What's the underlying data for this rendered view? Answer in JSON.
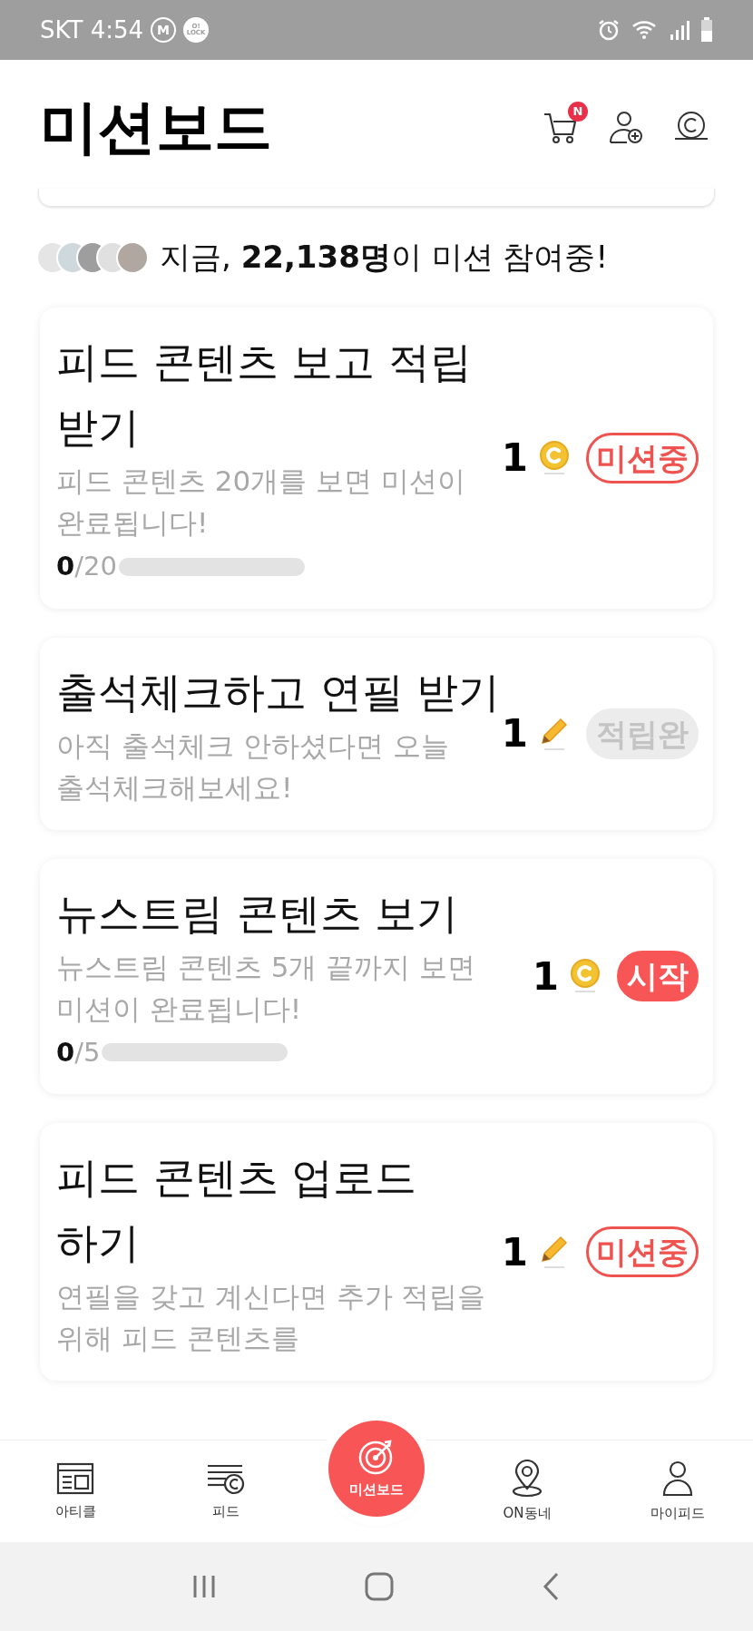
{
  "status_bar": {
    "carrier_time": "SKT 4:54",
    "app_badges": [
      "M",
      "O! LOCK"
    ]
  },
  "header": {
    "title": "미션보드",
    "cart_badge": "N"
  },
  "participants": {
    "text": "지금, **22,138명**이 미션 참여중!"
  },
  "missions": [
    {
      "title": "피드 콘텐츠 보고 적립 받기",
      "description": "피드 콘텐츠 20개를 보면 미션이 완료됩니다!",
      "reward": {
        "amount": "1",
        "kind": "coin"
      },
      "status": {
        "kind": "in_progress",
        "label": "미션중"
      },
      "progress": {
        "current": "0",
        "total": "/20",
        "level": 0
      }
    },
    {
      "title": "출석체크하고 연필 받기",
      "description": "아직 출석체크 안하셨다면 오늘 출석체크해보세요!",
      "reward": {
        "amount": "1",
        "kind": "pencil"
      },
      "status": {
        "kind": "completed",
        "label": "적립완"
      }
    },
    {
      "title": "뉴스트림 콘텐츠 보기",
      "description": "뉴스트림 콘텐츠 5개 끝까지 보면 미션이 완료됩니다!",
      "reward": {
        "amount": "1",
        "kind": "coin"
      },
      "status": {
        "kind": "start",
        "label": "시작"
      },
      "progress": {
        "current": "0",
        "total": "/5",
        "level": 0
      }
    },
    {
      "title": "피드 콘텐츠 업로드 하기",
      "description": "연필을 갖고 계신다면 추가 적립을 위해 피드 콘텐츠를",
      "reward": {
        "amount": "1",
        "kind": "pencil"
      },
      "status": {
        "kind": "in_progress",
        "label": "미션중"
      }
    }
  ],
  "bottom_nav": [
    {
      "label": "아티클",
      "selected": false
    },
    {
      "label": "피드",
      "selected": false
    },
    {
      "label": "미션보드",
      "selected": true
    },
    {
      "label": "ON동네",
      "selected": false
    },
    {
      "label": "마이피드",
      "selected": false
    }
  ]
}
